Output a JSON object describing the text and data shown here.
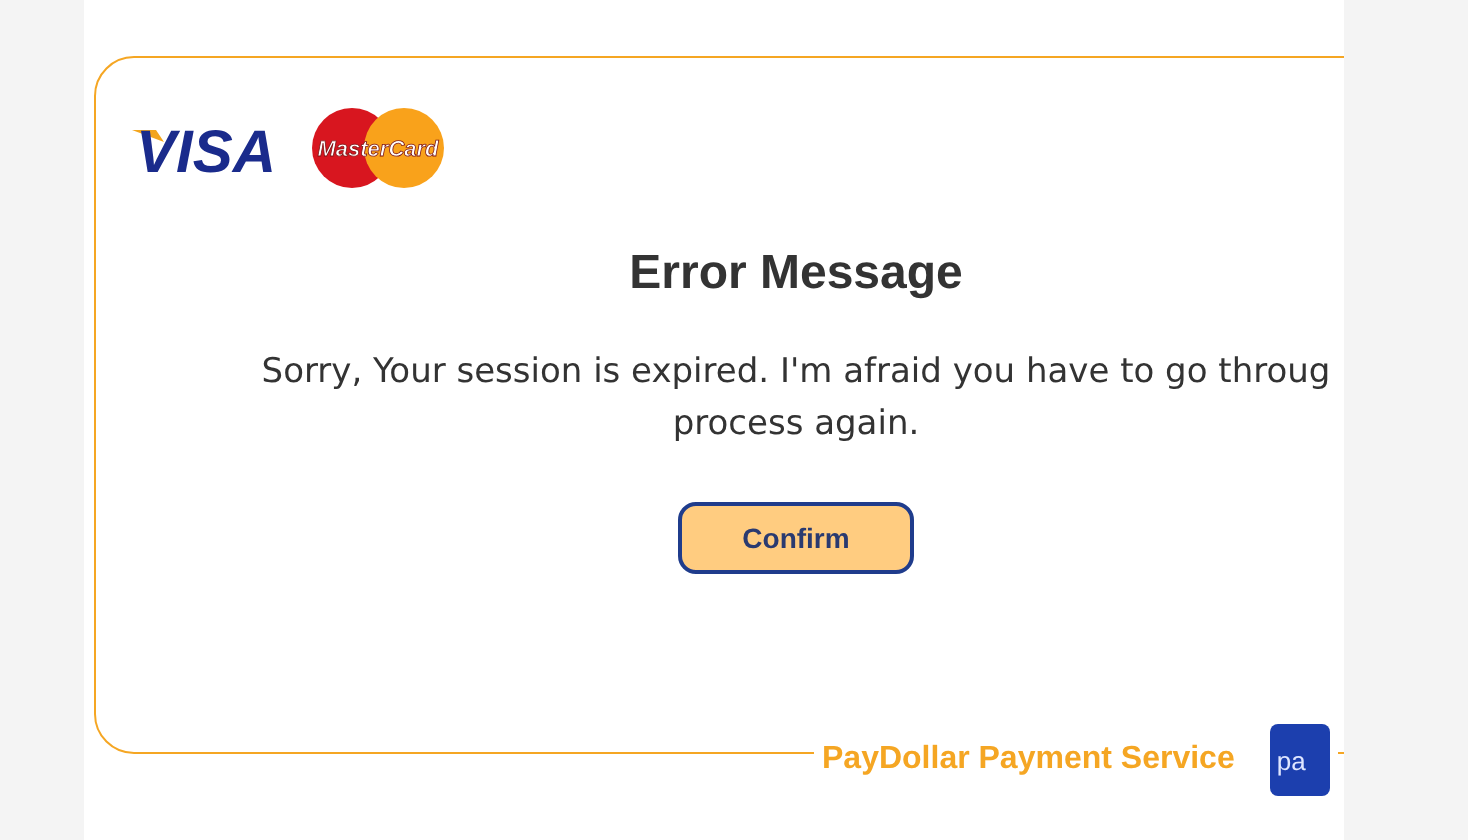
{
  "logos": {
    "visa": "VISA",
    "mastercard": "MasterCard"
  },
  "title": "Error Message",
  "message": [
    "Sorry, Your session is expired. I'm afraid you have to go throug",
    "process again."
  ],
  "confirm_button": "Confirm",
  "footer": {
    "service": "PayDollar Payment Service",
    "logo_text": "pa"
  }
}
